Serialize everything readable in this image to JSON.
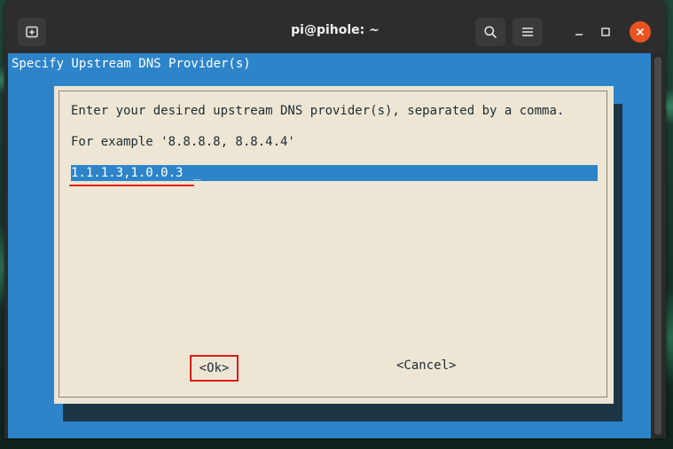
{
  "window": {
    "title": "pi@pihole: ~",
    "new_tab_icon": "new-tab-icon",
    "search_icon": "search-icon",
    "menu_icon": "hamburger-menu-icon",
    "minimize_icon": "minimize-icon",
    "maximize_icon": "maximize-icon",
    "close_icon": "close-icon"
  },
  "terminal": {
    "backtitle": "Specify Upstream DNS Provider(s)",
    "dialog": {
      "line1": "Enter your desired upstream DNS provider(s), separated by a comma.",
      "line2": "For example '8.8.8.8, 8.8.4.4'",
      "input_value": "1.1.1.3,1.0.0.3",
      "cursor": "_",
      "ok_label": "<Ok>",
      "cancel_label": "<Cancel>"
    }
  },
  "colors": {
    "dialog_backdrop": "#2d84c9",
    "dialog_bg": "#ede6d4",
    "highlight": "#e01b1b",
    "close_button": "#e95420"
  }
}
